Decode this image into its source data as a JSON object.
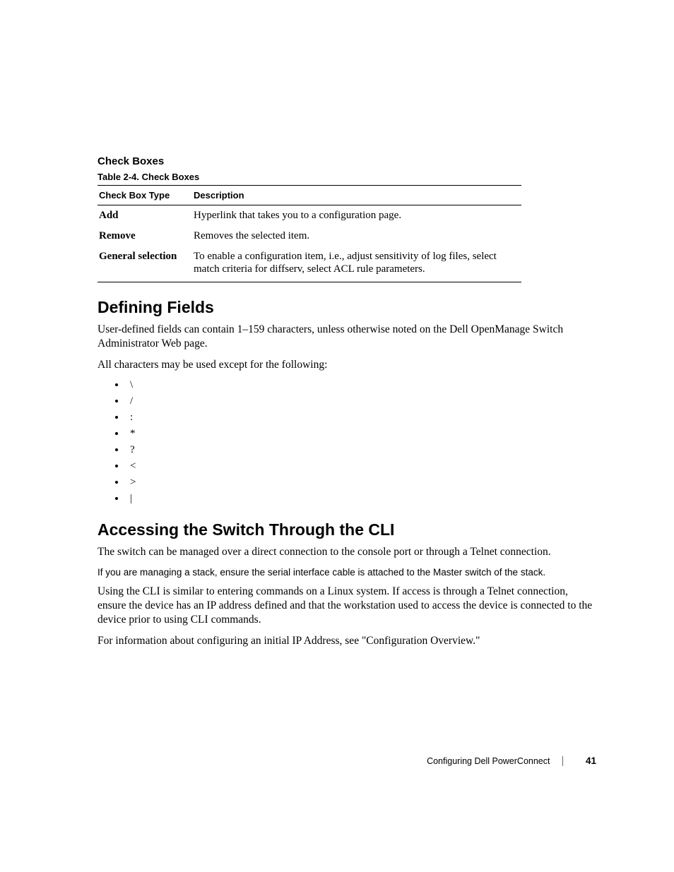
{
  "section1_heading": "Check Boxes",
  "table_caption": "Table 2-4.    Check Boxes",
  "table": {
    "headers": [
      "Check Box Type",
      "Description"
    ],
    "rows": [
      {
        "type": "Add",
        "desc": "Hyperlink that takes you to a configuration page."
      },
      {
        "type": "Remove",
        "desc": "Removes the selected item."
      },
      {
        "type": "General selection",
        "desc": "To enable a configuration item, i.e., adjust sensitivity of log files, select match criteria for diffserv, select ACL rule parameters."
      }
    ]
  },
  "h2_defining": "Defining Fields",
  "p_defining_1": "User-defined fields can contain 1–159 characters, unless otherwise noted on the Dell OpenManage Switch Administrator Web page.",
  "p_defining_2": "All characters may be used except for the following:",
  "forbidden_chars": [
    "\\",
    "/",
    ":",
    "*",
    "?",
    "<",
    ">",
    "|"
  ],
  "h2_cli": "Accessing the Switch Through the CLI",
  "p_cli_1": "The switch can be managed over a direct connection to the console port or through a Telnet connection.",
  "p_cli_note": "If you are managing a stack, ensure the serial interface cable is attached to the Master switch of the stack.",
  "p_cli_2": "Using the CLI is similar to entering commands on a Linux system. If access is through a Telnet connection, ensure the device has an IP address defined and that the workstation used to access the device is connected to the device prior to using CLI commands.",
  "p_cli_3": "For information about configuring an initial IP Address, see \"Configuration Overview.\"",
  "footer_title": "Configuring Dell PowerConnect",
  "footer_page": "41"
}
